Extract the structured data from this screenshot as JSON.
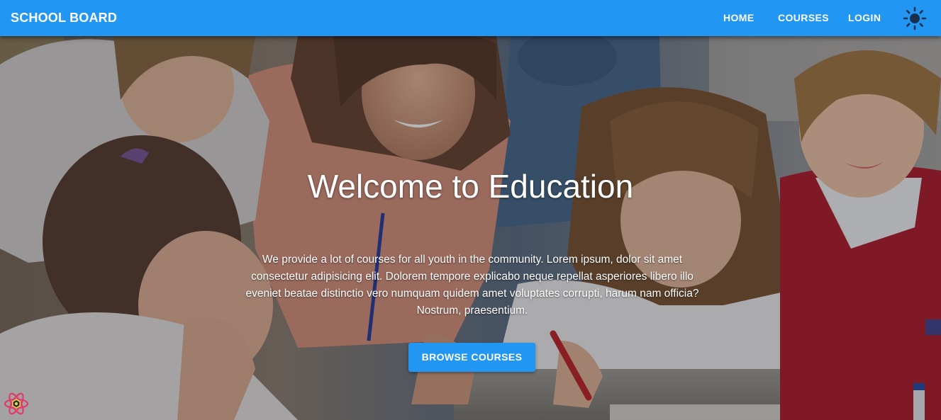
{
  "appbar": {
    "brand": "SCHOOL BOARD",
    "nav": {
      "home": "HOME",
      "courses": "COURSES",
      "login": "LOGIN"
    },
    "theme_toggle_icon": "sun-icon",
    "color": "#2196f3"
  },
  "hero": {
    "title": "Welcome to Education",
    "description": "We provide a lot of courses for all youth in the community. Lorem ipsum, dolor sit amet consectetur adipisicing elit. Dolorem tempore explicabo neque repellat asperiores libero illo eveniet beatae distinctio vero numquam quidem amet voluptates corrupti, harum nam officia? Nostrum, praesentium.",
    "cta_label": "BROWSE COURSES",
    "background_image": "classroom-photo",
    "cta_color": "#2196f3"
  },
  "devtools": {
    "icon": "react-devtools-icon"
  }
}
